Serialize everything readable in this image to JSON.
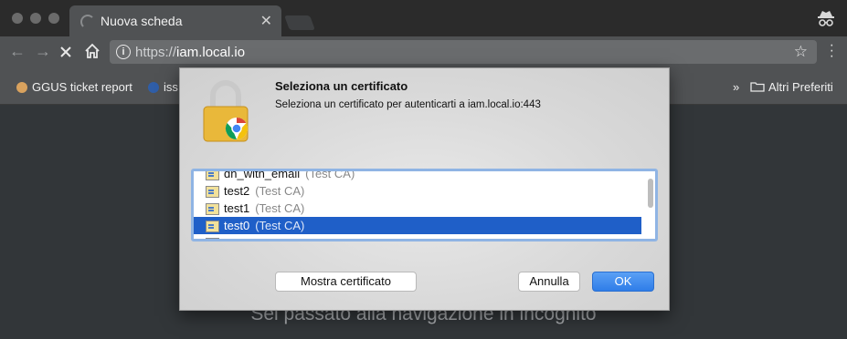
{
  "browser": {
    "tab_title": "Nuova scheda",
    "tab_close": "✕",
    "url_scheme": "https://",
    "url_host": "iam.local.io",
    "star": "☆"
  },
  "bookmarks": {
    "item1": "GGUS ticket report",
    "item2": "iss",
    "overflow": "»",
    "other": "Altri Preferiti"
  },
  "page": {
    "incognito_text": "Sei passato alla navigazione in incognito"
  },
  "dialog": {
    "title": "Seleziona un certificato",
    "subtitle": "Seleziona un certificato per autenticarti a iam.local.io:443",
    "certificates": [
      {
        "name": "dn_with_email",
        "issuer": "(Test CA)"
      },
      {
        "name": "test2",
        "issuer": "(Test CA)"
      },
      {
        "name": "test1",
        "issuer": "(Test CA)"
      },
      {
        "name": "test0",
        "issuer": "(Test CA)",
        "selected": true
      }
    ],
    "show_cert_button": "Mostra certificato",
    "cancel_button": "Annulla",
    "ok_button": "OK"
  },
  "colors": {
    "selection": "#1f5fc8",
    "ok_button": "#2f7de8"
  }
}
